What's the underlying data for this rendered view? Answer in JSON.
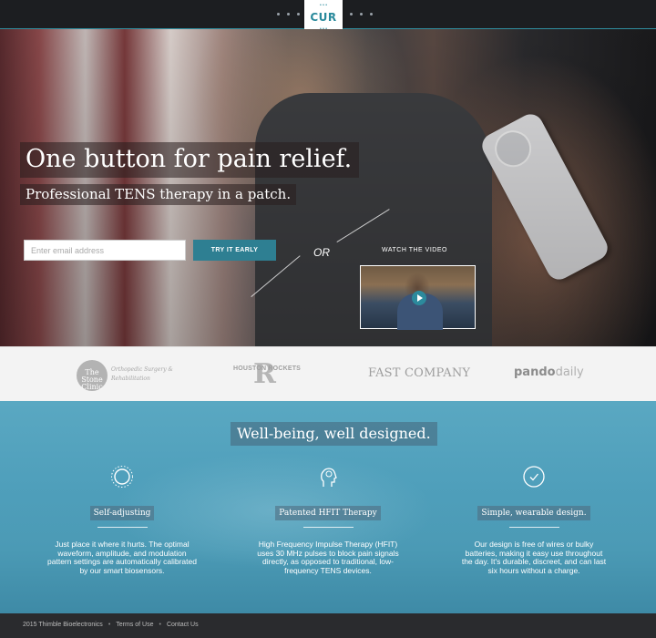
{
  "header": {
    "logo_text": "CUR",
    "icons": [
      "dots-left",
      "dots-right"
    ]
  },
  "hero": {
    "headline": "One button for pain relief.",
    "subhead": "Professional TENS therapy in a patch.",
    "email_placeholder": "Enter email address",
    "cta_label": "TRY IT EARLY",
    "or_text": "OR",
    "watch_label": "WATCH THE VIDEO"
  },
  "press": {
    "stone_name": "The Stone Clinic",
    "stone_sub": "Orthopedic Surgery & Rehabilitation",
    "rockets_text": "HOUSTON ROCKETS",
    "rockets_mark": "R",
    "fastco": "FAST COMPANY",
    "pando_bold": "pando",
    "pando_light": "daily"
  },
  "features": {
    "title": "Well-being, well designed.",
    "items": [
      {
        "icon": "self-adjust-icon",
        "label": "Self-adjusting",
        "body": "Just place it where it hurts.  The optimal waveform, amplitude, and modulation pattern settings are automatically calibrated by our smart biosensors."
      },
      {
        "icon": "head-icon",
        "label": "Patented HFIT Therapy",
        "body": "High Frequency Impulse Therapy (HFIT) uses 30 MHz pulses to block pain signals directly, as opposed to traditional, low-frequency TENS devices."
      },
      {
        "icon": "checkmark-icon",
        "label": "Simple, wearable design.",
        "body": "Our design is free of wires or bulky batteries, making it easy use throughout the day. It's durable, discreet, and can last six hours without a charge."
      }
    ]
  },
  "footer": {
    "copyright": "2015 Thimble Bioelectronics",
    "terms": "Terms of Use",
    "contact": "Contact Us",
    "separator": "•"
  },
  "colors": {
    "accent": "#2e7f92",
    "feature_bg": "#4f9fbb",
    "footer_bg": "#2a2b2e"
  }
}
